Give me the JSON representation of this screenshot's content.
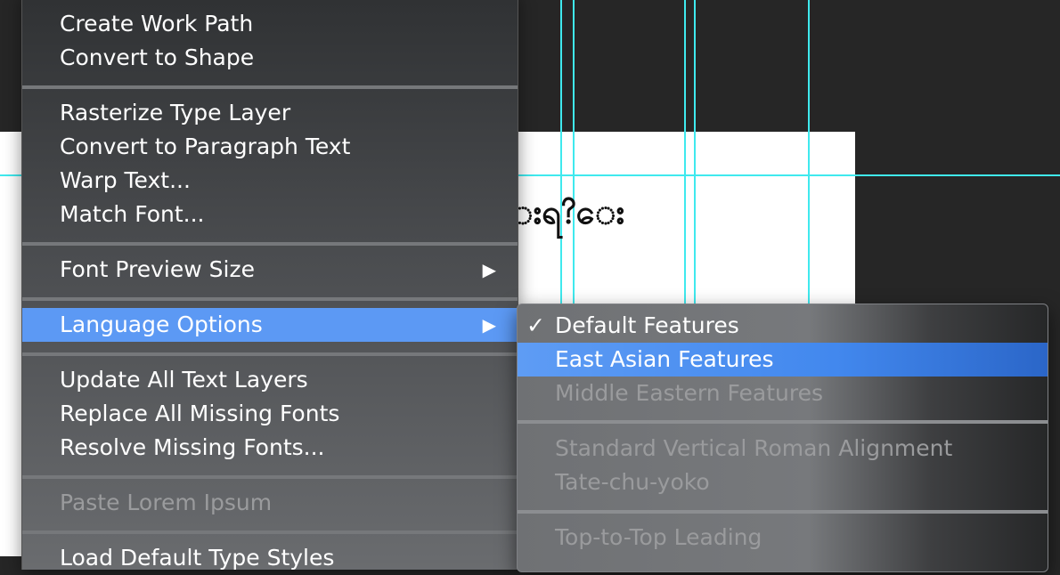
{
  "canvas": {
    "sample_text": "းရ?ေး"
  },
  "menu": {
    "items": [
      {
        "label": "Create Work Path"
      },
      {
        "label": "Convert to Shape"
      },
      {
        "label": "Rasterize Type Layer"
      },
      {
        "label": "Convert to Paragraph Text"
      },
      {
        "label": "Warp Text..."
      },
      {
        "label": "Match Font..."
      },
      {
        "label": "Font Preview Size",
        "submenu_arrow": "▶"
      },
      {
        "label": "Language Options",
        "submenu_arrow": "▶"
      },
      {
        "label": "Update All Text Layers"
      },
      {
        "label": "Replace All Missing Fonts"
      },
      {
        "label": "Resolve Missing Fonts..."
      },
      {
        "label": "Paste Lorem Ipsum"
      },
      {
        "label": "Load Default Type Styles"
      }
    ]
  },
  "submenu": {
    "check_mark": "✓",
    "items": [
      {
        "label": "Default Features"
      },
      {
        "label": "East Asian Features"
      },
      {
        "label": "Middle Eastern Features"
      },
      {
        "label": "Standard Vertical Roman Alignment"
      },
      {
        "label": "Tate-chu-yoko"
      },
      {
        "label": "Top-to-Top Leading"
      }
    ]
  },
  "colors": {
    "highlight": "#5c99f4",
    "guide": "#3fe9ee",
    "disabled_text": "#9a9b9d"
  }
}
